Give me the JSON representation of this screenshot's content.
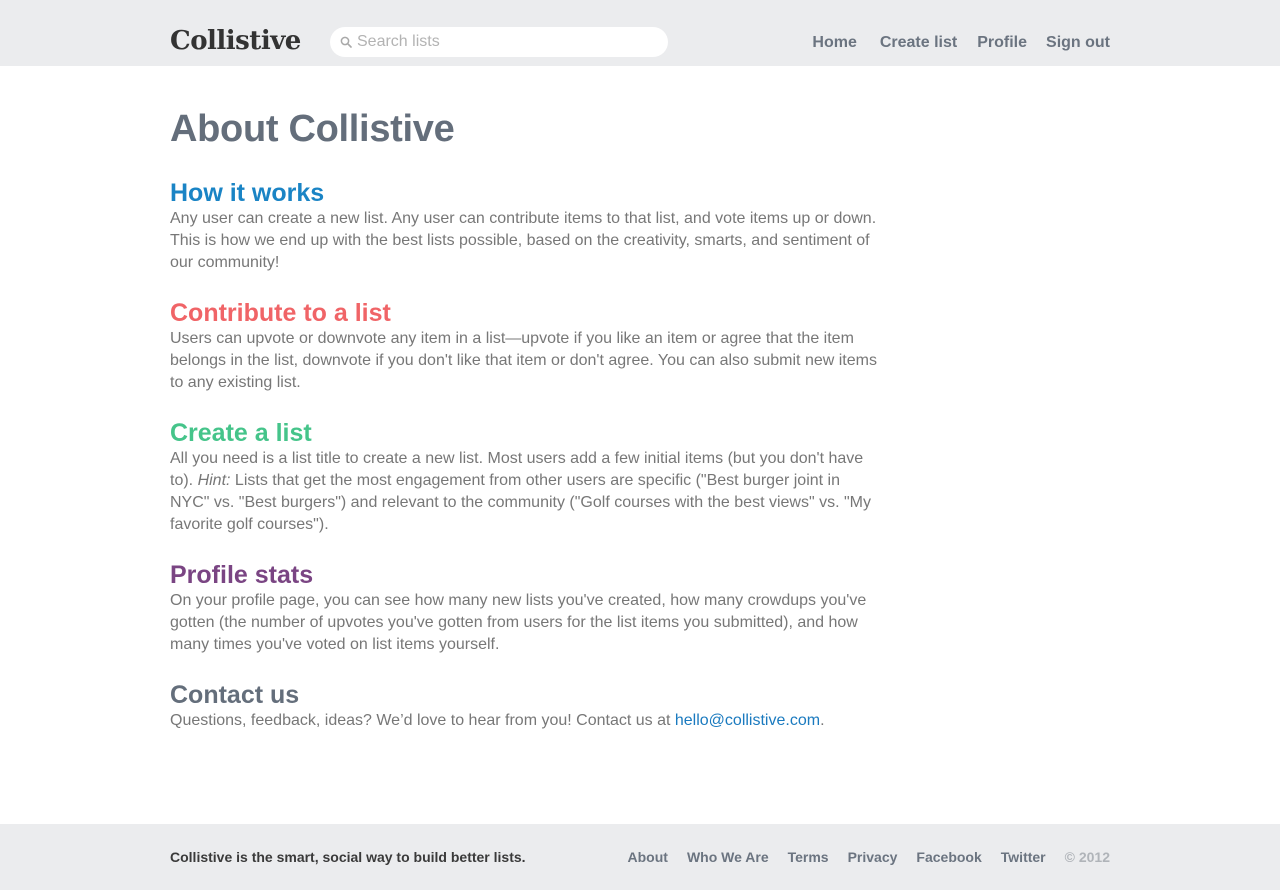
{
  "header": {
    "logo": "Collistive",
    "search_placeholder": "Search lists",
    "nav": {
      "home": "Home",
      "create_list": "Create list",
      "profile": "Profile",
      "sign_out": "Sign out"
    }
  },
  "main": {
    "title": "About Collistive",
    "sections": [
      {
        "heading": "How it works",
        "body": "Any user can create a new list. Any user can contribute items to that list, and vote items up or down. This is how we end up with the best lists possible, based on the creativity, smarts, and sentiment of our community!"
      },
      {
        "heading": "Contribute to a list",
        "body": "Users can upvote or downvote any item in a list—upvote if you like an item or agree that the item belongs in the list, downvote if you don't like that item or don't agree. You can also submit new items to any existing list."
      },
      {
        "heading": "Create a list",
        "body_before": "All you need is a list title to create a new list. Most users add a few initial items (but you don't have to). ",
        "hint_label": "Hint:",
        "body_after": " Lists that get the most engagement from other users are specific (\"Best burger joint in NYC\" vs. \"Best burgers\") and relevant to the community (\"Golf courses with the best views\" vs. \"My favorite golf courses\")."
      },
      {
        "heading": "Profile stats",
        "body": "On your profile page, you can see how many new lists you've created, how many crowdups you've gotten (the number of upvotes you've gotten from users for the list items you submitted), and how many times you've voted on list items yourself."
      },
      {
        "heading": "Contact us",
        "body_before": "Questions, feedback, ideas? We’d love to hear from you! Contact us at ",
        "email": "hello@collistive.com",
        "body_after": "."
      }
    ]
  },
  "footer": {
    "tagline": "Collistive is the smart, social way to build better lists.",
    "links": {
      "about": "About",
      "who_we_are": "Who We Are",
      "terms": "Terms",
      "privacy": "Privacy",
      "facebook": "Facebook",
      "twitter": "Twitter"
    },
    "copyright": "© 2012"
  },
  "colors": {
    "how_it_works": "#1a84c5",
    "contribute": "#f06467",
    "create": "#45c48a",
    "profile_stats": "#7a4583",
    "contact": "#646e7b",
    "bar_background": "#ebecee"
  }
}
